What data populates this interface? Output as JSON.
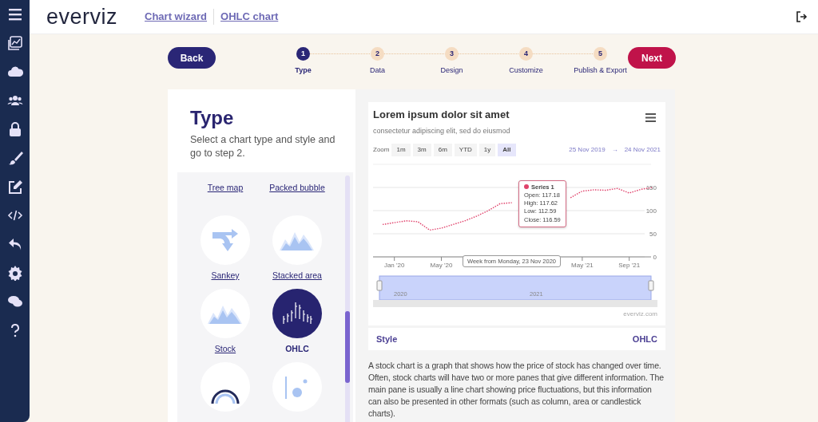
{
  "header": {
    "logo": "everviz",
    "breadcrumbs": [
      "Chart wizard",
      "OHLC chart"
    ]
  },
  "wizard": {
    "back": "Back",
    "next": "Next",
    "steps": [
      {
        "number": "1",
        "label": "Type",
        "selected": true
      },
      {
        "number": "2",
        "label": "Data",
        "selected": false
      },
      {
        "number": "3",
        "label": "Design",
        "selected": false
      },
      {
        "number": "4",
        "label": "Customize",
        "selected": false
      },
      {
        "number": "5",
        "label": "Publish & Export",
        "selected": false
      }
    ]
  },
  "type_panel": {
    "title": "Type",
    "subtitle": "Select a chart type and style and go to step 2.",
    "chart_types": [
      {
        "label": "Tree map",
        "kind": "hidden",
        "selected": false
      },
      {
        "label": "Packed bubble",
        "kind": "hidden",
        "selected": false
      },
      {
        "label": "Sankey",
        "kind": "sankey",
        "selected": false
      },
      {
        "label": "Stacked area",
        "kind": "area",
        "selected": false
      },
      {
        "label": "Stock",
        "kind": "area",
        "selected": false
      },
      {
        "label": "OHLC",
        "kind": "ohlc",
        "selected": true
      },
      {
        "kind": "gauge",
        "selected": false
      },
      {
        "kind": "scatter",
        "selected": false
      }
    ]
  },
  "preview": {
    "title": "Lorem ipsum dolor sit amet",
    "subtitle": "consectetur adipiscing elit, sed do eiusmod",
    "zoom": {
      "label": "Zoom",
      "buttons": [
        {
          "label": "1m",
          "selected": false
        },
        {
          "label": "3m",
          "selected": false
        },
        {
          "label": "6m",
          "selected": false
        },
        {
          "label": "YTD",
          "selected": false
        },
        {
          "label": "1y",
          "selected": false
        },
        {
          "label": "All",
          "selected": true
        }
      ]
    },
    "range": {
      "from": "25 Nov 2019",
      "arrow": "→",
      "to": "24 Nov 2021"
    },
    "tooltip": {
      "lines": [
        "Open: 117.18",
        "High: 117.62",
        "Low: 112.59",
        "Close: 116.59"
      ]
    },
    "x_tooltip": "Week from Monday, 23 Nov 2020",
    "navigator": {
      "labels": [
        "2020",
        "2021"
      ]
    },
    "credit": "everviz.com",
    "chart_data": {
      "type": "line",
      "categories": [
        null,
        "Jan '20",
        null,
        null,
        null,
        "May '20",
        null,
        null,
        null,
        null,
        null,
        null,
        null,
        null,
        null,
        null,
        null,
        "May '21",
        null,
        null,
        null,
        "Sep '21",
        null,
        null
      ],
      "series": [
        {
          "name": "Series 1",
          "color": "#e0426b",
          "line_style": "dashed",
          "values": [
            70,
            74,
            78,
            76,
            58,
            62,
            70,
            78,
            88,
            100,
            115,
            117,
            null,
            null,
            null,
            null,
            128,
            142,
            145,
            144,
            148,
            138,
            146,
            150
          ]
        }
      ],
      "ylim": [
        0,
        200
      ],
      "yticks": [
        0,
        50,
        100,
        150
      ],
      "grid": true
    }
  },
  "style": {
    "label": "Style",
    "value": "OHLC"
  },
  "description": "A stock chart is a graph that shows how the price of stock has changed over time. Often, stock charts will have two or more panes that give different information. The main pane is usually a line chart showing price fluctuations, but this information can also be presented in other formats (such as column, area or candlestick charts)."
}
